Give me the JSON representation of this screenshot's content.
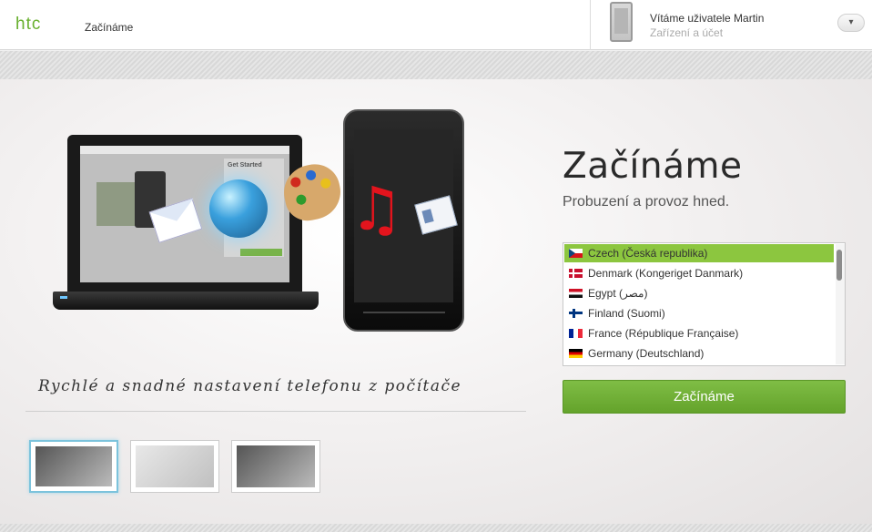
{
  "header": {
    "logo": "htc",
    "title": "Začínáme",
    "account": {
      "greeting": "Vítáme uživatele Martin",
      "subtitle": "Zařízení a účet",
      "dropdown_icon": "▾"
    }
  },
  "hero": {
    "laptop_screen_heading": "Get Started",
    "tagline": "Rychlé a snadné nastavení telefonu z počítače",
    "note_glyph": "♫",
    "thumbnails": [
      {
        "name": "laptop-phone-slide",
        "active": true
      },
      {
        "name": "cloud-services-slide",
        "active": false
      },
      {
        "name": "phones-slide",
        "active": false
      }
    ]
  },
  "panel": {
    "title": "Začínáme",
    "subtitle": "Probuzení a provoz hned.",
    "languages": [
      {
        "label": "Czech (Česká republika)",
        "selected": true
      },
      {
        "label": "Denmark (Kongeriget Danmark)",
        "selected": false
      },
      {
        "label": "Egypt (مصر)",
        "selected": false
      },
      {
        "label": "Finland (Suomi)",
        "selected": false
      },
      {
        "label": "France (République Française)",
        "selected": false
      },
      {
        "label": "Germany (Deutschland)",
        "selected": false
      }
    ],
    "button_label": "Začínáme"
  },
  "colors": {
    "brand_green": "#68b02e",
    "selected_row": "#8cc63f",
    "button": "#6fb037"
  }
}
